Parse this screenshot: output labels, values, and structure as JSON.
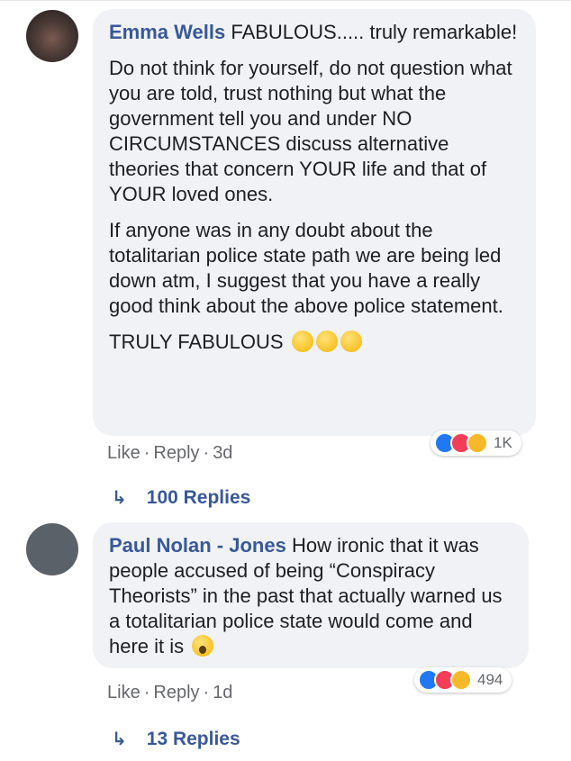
{
  "comments": [
    {
      "author": "Emma Wells",
      "paragraphs": [
        "FABULOUS..... truly remarkable!",
        "Do not think for yourself, do not question what you are told, trust nothing but what the government tell you and under NO CIRCUMSTANCES discuss alternative theories that concern YOUR life and that of YOUR loved ones.",
        "If anyone was in any doubt about the totalitarian police state path we are being led down atm, I suggest that you have a really good think about the above police statement.",
        "TRULY FABULOUS"
      ],
      "reaction_count": "1K",
      "actions": {
        "like": "Like",
        "reply": "Reply",
        "time": "3d"
      },
      "replies_label": "100 Replies"
    },
    {
      "author": "Paul Nolan - Jones",
      "paragraphs": [
        "How ironic that it was people accused of being “Conspiracy Theorists” in the past that actually warned us a totalitarian police state would come and here it is"
      ],
      "reaction_count": "494",
      "actions": {
        "like": "Like",
        "reply": "Reply",
        "time": "1d"
      },
      "replies_label": "13 Replies"
    }
  ],
  "icons": {
    "reply_arrow": "reply-arrow-icon",
    "reactions": [
      "like-icon",
      "love-icon",
      "haha-icon"
    ],
    "emoji_laugh": "laughing-emoji-icon",
    "emoji_wow": "wow-emoji-icon"
  },
  "colors": {
    "author": "#385898",
    "bubble": "#f0f2f5",
    "meta": "#65676b",
    "like": "#2078f4",
    "love": "#f33e58",
    "haha": "#f7b928"
  }
}
